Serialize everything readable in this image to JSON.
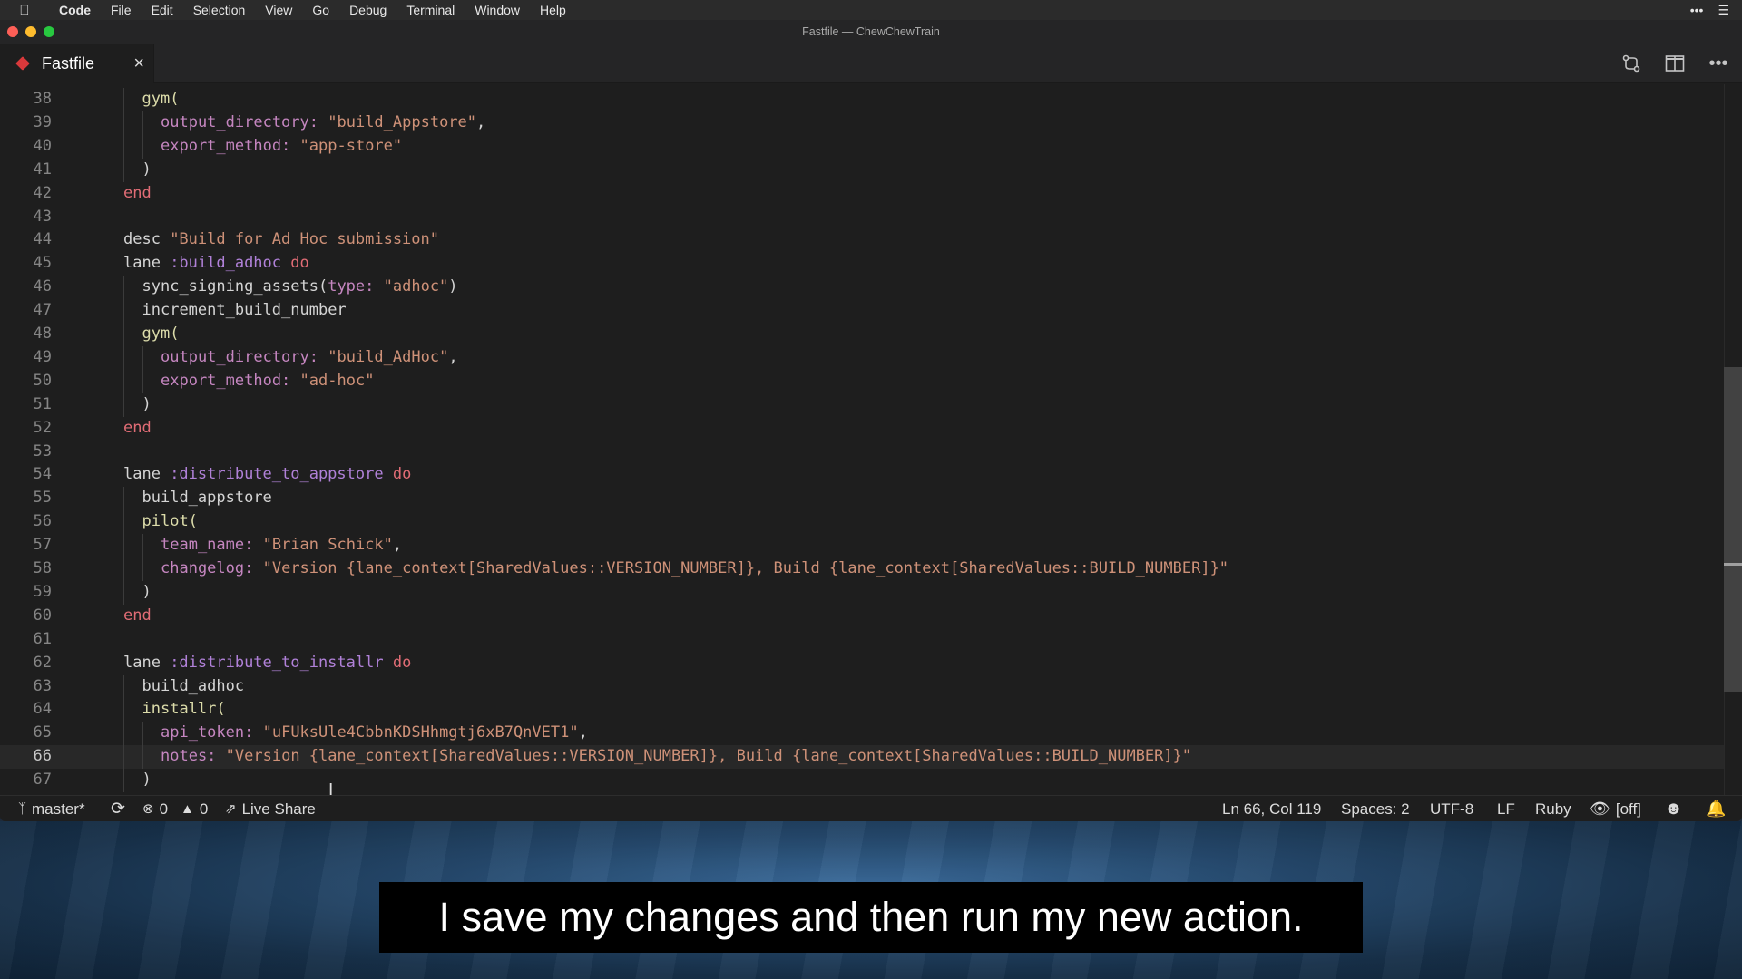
{
  "menubar": {
    "app_name": "Code",
    "items": [
      "File",
      "Edit",
      "Selection",
      "View",
      "Go",
      "Debug",
      "Terminal",
      "Window",
      "Help"
    ],
    "icons": [
      "apple-icon",
      "more-icon",
      "list-icon"
    ]
  },
  "window": {
    "title": "Fastfile — ChewChewTrain",
    "tab": {
      "label": "Fastfile",
      "close_symbol": "×"
    },
    "tab_actions": [
      "source-control-icon",
      "split-editor-icon",
      "more-actions-icon"
    ]
  },
  "editor": {
    "language_color": "#d8393b",
    "current_line": 66,
    "lines": [
      {
        "n": "38",
        "indent": 2,
        "tokens": [
          [
            "fn",
            "gym("
          ]
        ]
      },
      {
        "n": "39",
        "indent": 3,
        "tokens": [
          [
            "key",
            "output_directory:"
          ],
          [
            "plain",
            " "
          ],
          [
            "str",
            "\"build_Appstore\""
          ],
          [
            "plain",
            ","
          ]
        ]
      },
      {
        "n": "40",
        "indent": 3,
        "tokens": [
          [
            "key",
            "export_method:"
          ],
          [
            "plain",
            " "
          ],
          [
            "str",
            "\"app-store\""
          ]
        ]
      },
      {
        "n": "41",
        "indent": 2,
        "tokens": [
          [
            "plain",
            ")"
          ]
        ]
      },
      {
        "n": "42",
        "indent": 1,
        "tokens": [
          [
            "end",
            "end"
          ]
        ]
      },
      {
        "n": "43",
        "indent": 1,
        "tokens": []
      },
      {
        "n": "44",
        "indent": 1,
        "tokens": [
          [
            "plain",
            "desc "
          ],
          [
            "str",
            "\"Build for Ad Hoc submission\""
          ]
        ]
      },
      {
        "n": "45",
        "indent": 1,
        "tokens": [
          [
            "plain",
            "lane "
          ],
          [
            "sym",
            ":build_adhoc"
          ],
          [
            "plain",
            " "
          ],
          [
            "end",
            "do"
          ]
        ]
      },
      {
        "n": "46",
        "indent": 2,
        "tokens": [
          [
            "plain",
            "sync_signing_assets("
          ],
          [
            "key",
            "type:"
          ],
          [
            "plain",
            " "
          ],
          [
            "str",
            "\"adhoc\""
          ],
          [
            "plain",
            ")"
          ]
        ]
      },
      {
        "n": "47",
        "indent": 2,
        "tokens": [
          [
            "plain",
            "increment_build_number"
          ]
        ]
      },
      {
        "n": "48",
        "indent": 2,
        "tokens": [
          [
            "fn",
            "gym("
          ]
        ]
      },
      {
        "n": "49",
        "indent": 3,
        "tokens": [
          [
            "key",
            "output_directory:"
          ],
          [
            "plain",
            " "
          ],
          [
            "str",
            "\"build_AdHoc\""
          ],
          [
            "plain",
            ","
          ]
        ]
      },
      {
        "n": "50",
        "indent": 3,
        "tokens": [
          [
            "key",
            "export_method:"
          ],
          [
            "plain",
            " "
          ],
          [
            "str",
            "\"ad-hoc\""
          ]
        ]
      },
      {
        "n": "51",
        "indent": 2,
        "tokens": [
          [
            "plain",
            ")"
          ]
        ]
      },
      {
        "n": "52",
        "indent": 1,
        "tokens": [
          [
            "end",
            "end"
          ]
        ]
      },
      {
        "n": "53",
        "indent": 1,
        "tokens": []
      },
      {
        "n": "54",
        "indent": 1,
        "tokens": [
          [
            "plain",
            "lane "
          ],
          [
            "sym",
            ":distribute_to_appstore"
          ],
          [
            "plain",
            " "
          ],
          [
            "end",
            "do"
          ]
        ]
      },
      {
        "n": "55",
        "indent": 2,
        "tokens": [
          [
            "plain",
            "build_appstore"
          ]
        ]
      },
      {
        "n": "56",
        "indent": 2,
        "tokens": [
          [
            "fn",
            "pilot("
          ]
        ]
      },
      {
        "n": "57",
        "indent": 3,
        "tokens": [
          [
            "key",
            "team_name:"
          ],
          [
            "plain",
            " "
          ],
          [
            "str",
            "\"Brian Schick\""
          ],
          [
            "plain",
            ","
          ]
        ]
      },
      {
        "n": "58",
        "indent": 3,
        "tokens": [
          [
            "key",
            "changelog:"
          ],
          [
            "plain",
            " "
          ],
          [
            "str",
            "\"Version {lane_context[SharedValues::VERSION_NUMBER]}, Build {lane_context[SharedValues::BUILD_NUMBER]}\""
          ]
        ]
      },
      {
        "n": "59",
        "indent": 2,
        "tokens": [
          [
            "plain",
            ")"
          ]
        ]
      },
      {
        "n": "60",
        "indent": 1,
        "tokens": [
          [
            "end",
            "end"
          ]
        ]
      },
      {
        "n": "61",
        "indent": 1,
        "tokens": []
      },
      {
        "n": "62",
        "indent": 1,
        "tokens": [
          [
            "plain",
            "lane "
          ],
          [
            "sym",
            ":distribute_to_installr"
          ],
          [
            "plain",
            " "
          ],
          [
            "end",
            "do"
          ]
        ]
      },
      {
        "n": "63",
        "indent": 2,
        "tokens": [
          [
            "plain",
            "build_adhoc"
          ]
        ]
      },
      {
        "n": "64",
        "indent": 2,
        "tokens": [
          [
            "fn",
            "installr("
          ]
        ]
      },
      {
        "n": "65",
        "indent": 3,
        "tokens": [
          [
            "key",
            "api_token:"
          ],
          [
            "plain",
            " "
          ],
          [
            "str",
            "\"uFUksUle4CbbnKDSHhmgtj6xB7QnVET1\""
          ],
          [
            "plain",
            ","
          ]
        ]
      },
      {
        "n": "66",
        "indent": 3,
        "tokens": [
          [
            "key",
            "notes:"
          ],
          [
            "plain",
            " "
          ],
          [
            "str",
            "\"Version {lane_context[SharedValues::VERSION_NUMBER]}, Build {lane_context[SharedValues::BUILD_NUMBER]}\""
          ]
        ]
      },
      {
        "n": "67",
        "indent": 2,
        "tokens": [
          [
            "plain",
            ")"
          ]
        ]
      }
    ]
  },
  "statusbar": {
    "branch": "master*",
    "errors": "0",
    "warnings": "0",
    "live_share": "Live Share",
    "position": "Ln 66, Col 119",
    "spaces": "Spaces: 2",
    "encoding": "UTF-8",
    "eol": "LF",
    "language": "Ruby",
    "eye_status": "[off]"
  },
  "caption": "I save my changes and then run my new action."
}
